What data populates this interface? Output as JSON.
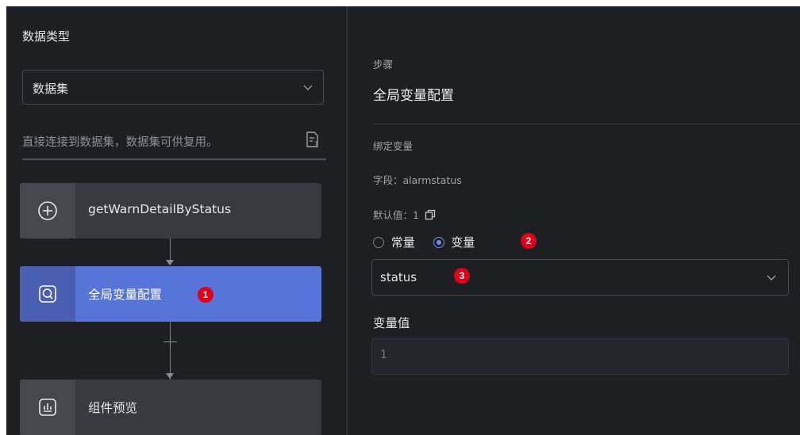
{
  "left": {
    "data_type_label": "数据类型",
    "data_type_value": "数据集",
    "description": "直接连接到数据集，数据集可供复用。",
    "steps": [
      {
        "name": "getWarnDetailByStatus",
        "icon": "plus-circle-icon",
        "active": false
      },
      {
        "name": "全局变量配置",
        "icon": "variable-search-icon",
        "active": true,
        "badge": "1"
      },
      {
        "name": "组件预览",
        "icon": "chart-preview-icon",
        "active": false
      }
    ]
  },
  "right": {
    "step_caption": "步骤",
    "step_title": "全局变量配置",
    "bind_label": "绑定变量",
    "field_text": "字段：alarmstatus",
    "default_text": "默认值：1",
    "radio_constant": "常量",
    "radio_variable": "变量",
    "radio_badge": "2",
    "variable_select_value": "status",
    "select_badge": "3",
    "variable_value_label": "变量值",
    "variable_value_placeholder": "1"
  },
  "colors": {
    "background": "#1e1f23",
    "active_step": "#5774d8",
    "accent": "#6f8cf0",
    "badge": "#e0001b"
  }
}
